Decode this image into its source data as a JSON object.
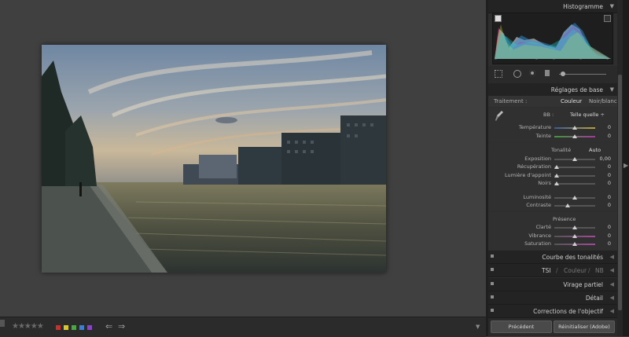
{
  "toolbar": {
    "stars": "★★★★★",
    "swatches": [
      "#c8302e",
      "#d7c72b",
      "#4aa842",
      "#3d7ecf",
      "#8a45c6"
    ],
    "prev_arrow": "⇐",
    "next_arrow": "⇒",
    "menu_arrow": "▼"
  },
  "panel": {
    "histogram": {
      "title": "Histogramme",
      "ticks": [
        "–",
        "–",
        "–",
        "–",
        "–"
      ]
    },
    "basic": {
      "title": "Réglages de base",
      "treatment_label": "Traitement :",
      "color": "Couleur",
      "bw": "Noir/blanc",
      "wb_label": "BB :",
      "wb_value": "Telle quelle ÷",
      "temperature": {
        "label": "Température",
        "value": "0",
        "pos": 0.5
      },
      "tint": {
        "label": "Teinte",
        "value": "0",
        "pos": 0.5
      },
      "tone_title": "Tonalité",
      "auto": "Auto",
      "exposure": {
        "label": "Exposition",
        "value": "0,00",
        "pos": 0.5
      },
      "recovery": {
        "label": "Récupération",
        "value": "0",
        "pos": 0.0
      },
      "fill": {
        "label": "Lumière d'appoint",
        "value": "0",
        "pos": 0.0
      },
      "blacks": {
        "label": "Noirs",
        "value": "0",
        "pos": 0.0
      },
      "brightness": {
        "label": "Luminosité",
        "value": "0",
        "pos": 0.5
      },
      "contrast": {
        "label": "Contraste",
        "value": "0",
        "pos": 0.33
      },
      "presence_title": "Présence",
      "clarity": {
        "label": "Clarté",
        "value": "0",
        "pos": 0.5
      },
      "vibrance": {
        "label": "Vibrance",
        "value": "0",
        "pos": 0.5
      },
      "saturation": {
        "label": "Saturation",
        "value": "0",
        "pos": 0.5
      }
    },
    "sections": {
      "tone_curve": "Courbe des tonalités",
      "hsl": "TSI",
      "hsl_color": "Couleur",
      "hsl_bw": "NB",
      "split": "Virage partiel",
      "detail": "Détail",
      "lens": "Corrections de l'objectif"
    },
    "buttons": {
      "previous": "Précédent",
      "reset": "Réinitialiser (Adobe)"
    }
  }
}
